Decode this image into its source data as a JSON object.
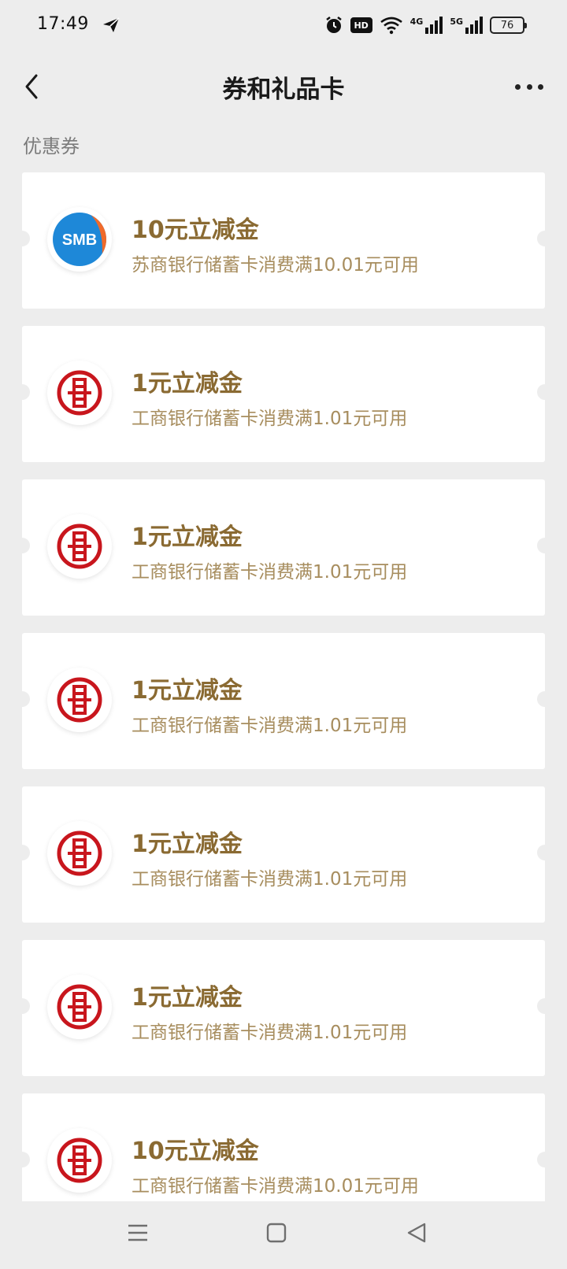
{
  "status_bar": {
    "time": "17:49",
    "hd_label": "HD",
    "signal_1": "4G",
    "signal_2": "5G",
    "battery": "76"
  },
  "nav": {
    "title": "券和礼品卡"
  },
  "section": {
    "label": "优惠券"
  },
  "coupons": [
    {
      "bank": "smb",
      "logo_text": "SMB",
      "title": "10元立减金",
      "desc": "苏商银行储蓄卡消费满10.01元可用"
    },
    {
      "bank": "icbc",
      "title": "1元立减金",
      "desc": "工商银行储蓄卡消费满1.01元可用"
    },
    {
      "bank": "icbc",
      "title": "1元立减金",
      "desc": "工商银行储蓄卡消费满1.01元可用"
    },
    {
      "bank": "icbc",
      "title": "1元立减金",
      "desc": "工商银行储蓄卡消费满1.01元可用"
    },
    {
      "bank": "icbc",
      "title": "1元立减金",
      "desc": "工商银行储蓄卡消费满1.01元可用"
    },
    {
      "bank": "icbc",
      "title": "1元立减金",
      "desc": "工商银行储蓄卡消费满1.01元可用"
    },
    {
      "bank": "icbc",
      "title": "10元立减金",
      "desc": "工商银行储蓄卡消费满10.01元可用"
    }
  ],
  "colors": {
    "title": "#8a6a32",
    "desc": "#a78d5e",
    "icbc_red": "#c8161d",
    "smb_blue": "#1e88d8",
    "smb_orange": "#f06a2a"
  }
}
